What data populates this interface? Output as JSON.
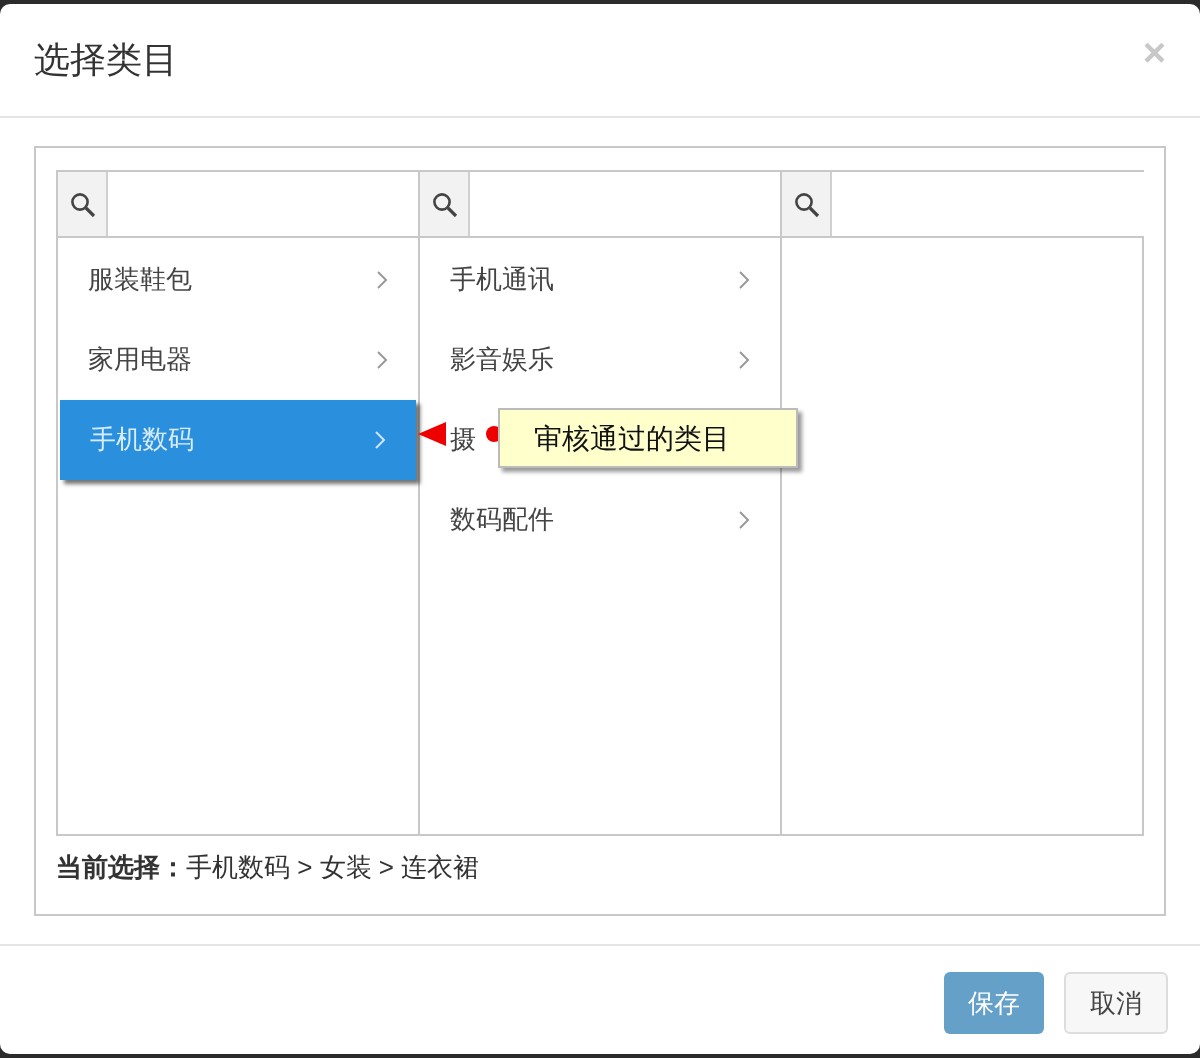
{
  "dialog": {
    "title": "选择类目",
    "close": "×"
  },
  "columns": [
    {
      "has_search": true,
      "items": [
        {
          "label": "服装鞋包",
          "selected": false,
          "expandable": true
        },
        {
          "label": "家用电器",
          "selected": false,
          "expandable": true
        },
        {
          "label": "手机数码",
          "selected": true,
          "expandable": true
        }
      ]
    },
    {
      "has_search": true,
      "items": [
        {
          "label": "手机通讯",
          "selected": false,
          "expandable": true
        },
        {
          "label": "影音娱乐",
          "selected": false,
          "expandable": true
        },
        {
          "label": "摄",
          "selected": false,
          "expandable": false
        },
        {
          "label": "数码配件",
          "selected": false,
          "expandable": true
        }
      ]
    },
    {
      "has_search": true
    }
  ],
  "callout": {
    "text": "审核通过的类目"
  },
  "current_selection": {
    "label": "当前选择：",
    "path": "手机数码 > 女装 > 连衣裙"
  },
  "buttons": [
    {
      "label": "保存",
      "kind": "primary"
    },
    {
      "label": "取消",
      "kind": "default"
    }
  ]
}
